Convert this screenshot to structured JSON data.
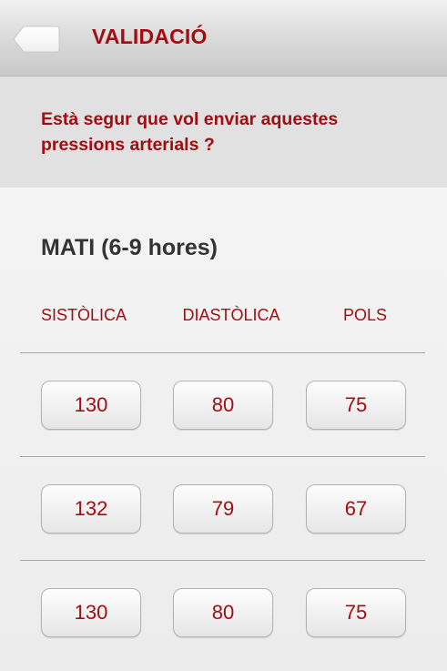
{
  "header": {
    "title": "VALIDACIÓ",
    "back_icon": "back-arrow-icon"
  },
  "confirm": {
    "message": "Està segur que vol enviar aquestes pressions arterials ?"
  },
  "section": {
    "title": "MATI (6-9 hores)"
  },
  "columns": [
    "SISTÒLICA",
    "DIASTÒLICA",
    "POLS"
  ],
  "rows": [
    [
      "130",
      "80",
      "75"
    ],
    [
      "132",
      "79",
      "67"
    ],
    [
      "130",
      "80",
      "75"
    ]
  ],
  "colors": {
    "accent": "#a30d12",
    "heading_text": "#333333"
  }
}
